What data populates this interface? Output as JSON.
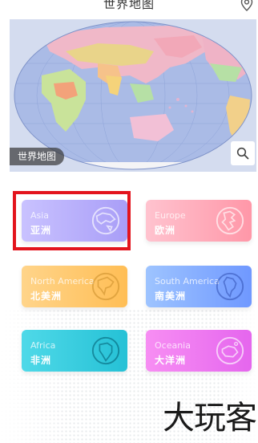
{
  "header": {
    "title": "世界地图",
    "location_icon": "location-pin-icon"
  },
  "map": {
    "label": "世界地图",
    "search_icon": "search-icon"
  },
  "continents": [
    {
      "en": "Asia",
      "cn": "亚洲",
      "icon": "globe-asia-icon",
      "color_from": "#c9c2ff",
      "color_to": "#a99ef7"
    },
    {
      "en": "Europe",
      "cn": "欧洲",
      "icon": "globe-europe-icon",
      "color_from": "#ffc3cf",
      "color_to": "#ff97a8"
    },
    {
      "en": "North America",
      "cn": "北美洲",
      "icon": "globe-north-america-icon",
      "color_from": "#ffd48a",
      "color_to": "#ffbe55"
    },
    {
      "en": "South America",
      "cn": "南美洲",
      "icon": "globe-south-america-icon",
      "color_from": "#9ec4ff",
      "color_to": "#6f98ff"
    },
    {
      "en": "Africa",
      "cn": "非洲",
      "icon": "globe-africa-icon",
      "color_from": "#4fd9e8",
      "color_to": "#25c1d6"
    },
    {
      "en": "Oceania",
      "cn": "大洋洲",
      "icon": "globe-oceania-icon",
      "color_from": "#f78ef3",
      "color_to": "#e566ee"
    }
  ],
  "selection": {
    "highlight_color": "#e3141d"
  },
  "watermark": "大玩客"
}
